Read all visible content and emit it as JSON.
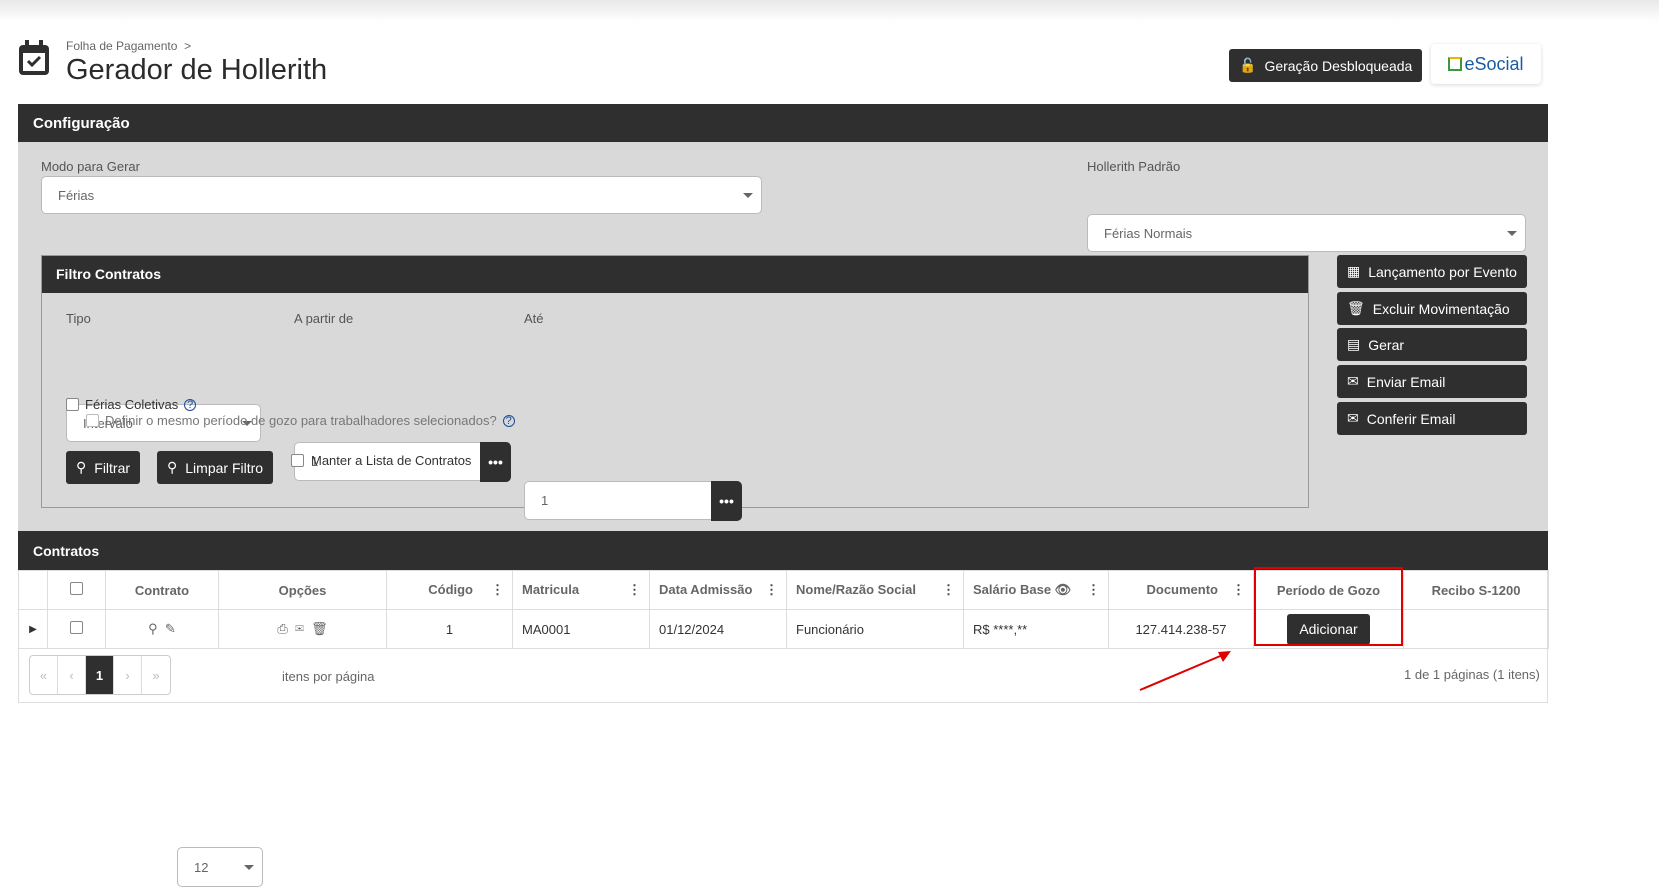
{
  "header": {
    "breadcrumb": "Folha de Pagamento",
    "breadcrumb_sep": ">",
    "title": "Gerador de Hollerith",
    "unlock_button": "Geração Desbloqueada",
    "esocial_logo": "eSocial"
  },
  "config": {
    "title": "Configuração",
    "modo_label": "Modo para Gerar",
    "modo_value": "Férias",
    "hollerith_label": "Hollerith Padrão",
    "hollerith_value": "Férias Normais"
  },
  "filtro": {
    "title": "Filtro Contratos",
    "tipo_label": "Tipo",
    "tipo_value": "Intervalo",
    "apartir_label": "A partir de",
    "apartir_value": "1",
    "ate_label": "Até",
    "ate_value": "1",
    "more": "•••",
    "ferias_coletivas": "Férias Coletivas",
    "definir": "Definir o mesmo período de gozo para trabalhadores selecionados?",
    "filtrar": "Filtrar",
    "limpar": "Limpar Filtro",
    "manter": "Manter a Lista de Contratos"
  },
  "side_buttons": [
    {
      "label": "Lançamento por Evento",
      "icon": "table-icon"
    },
    {
      "label": "Excluir Movimentação",
      "icon": "trash-icon"
    },
    {
      "label": "Gerar",
      "icon": "generate-icon"
    },
    {
      "label": "Enviar Email",
      "icon": "envelope-icon"
    },
    {
      "label": "Conferir Email",
      "icon": "envelope-check-icon"
    }
  ],
  "contratos": {
    "title": "Contratos",
    "columns": [
      "Contrato",
      "Opções",
      "Código",
      "Matricula",
      "Data Admissão",
      "Nome/Razão Social",
      "Salário Base",
      "Documento",
      "Período de Gozo",
      "Recibo S-1200"
    ],
    "row": {
      "codigo": "1",
      "matricula": "MA0001",
      "data": "01/12/2024",
      "nome": "Funcionário",
      "salario": "R$ ****,**",
      "documento": "127.414.238-57",
      "periodo_button": "Adicionar"
    },
    "pager": {
      "first": "«",
      "prev": "‹",
      "page": "1",
      "next": "›",
      "last": "»",
      "page_size": "12",
      "per_page_label": "itens por página",
      "summary": "1 de 1 páginas (1 itens)"
    }
  },
  "highlight_color": "#e00000"
}
